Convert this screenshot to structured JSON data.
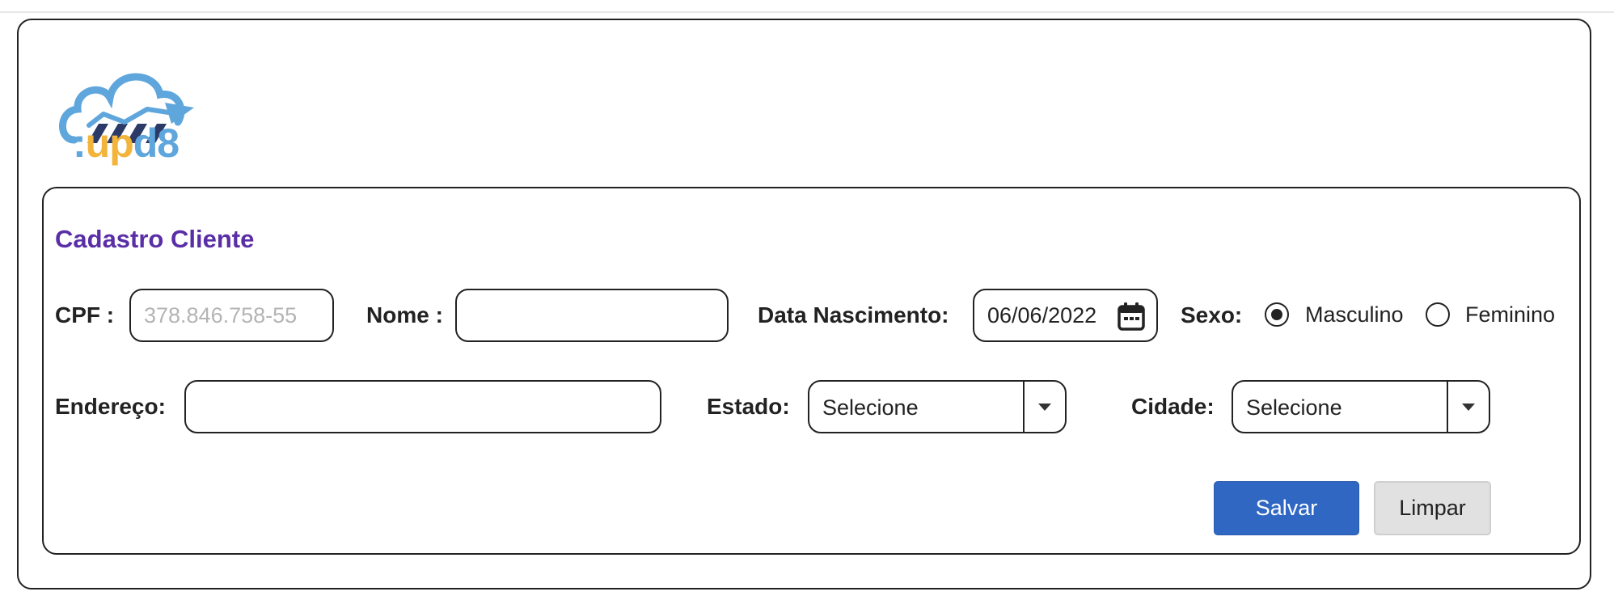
{
  "logo": {
    "part1": ":",
    "part2": "up",
    "part3": "d8"
  },
  "form": {
    "title": "Cadastro Cliente",
    "cpf": {
      "label": "CPF :",
      "value": "",
      "placeholder": "378.846.758-55"
    },
    "nome": {
      "label": "Nome :",
      "value": ""
    },
    "data_nascimento": {
      "label": "Data Nascimento:",
      "value": "06/06/2022",
      "icon": "calendar-icon"
    },
    "sexo": {
      "label": "Sexo:",
      "options": [
        {
          "label": "Masculino",
          "selected": true
        },
        {
          "label": "Feminino",
          "selected": false
        }
      ]
    },
    "endereco": {
      "label": "Endereço:",
      "value": ""
    },
    "estado": {
      "label": "Estado:",
      "selected": "Selecione"
    },
    "cidade": {
      "label": "Cidade:",
      "selected": "Selecione"
    },
    "buttons": {
      "save": "Salvar",
      "clear": "Limpar"
    }
  },
  "colors": {
    "title": "#5a2ea6",
    "primary_button": "#2f67c2",
    "logo_blue": "#5ea6dc",
    "logo_yellow": "#f2b43b",
    "logo_navy": "#2b3a67"
  }
}
